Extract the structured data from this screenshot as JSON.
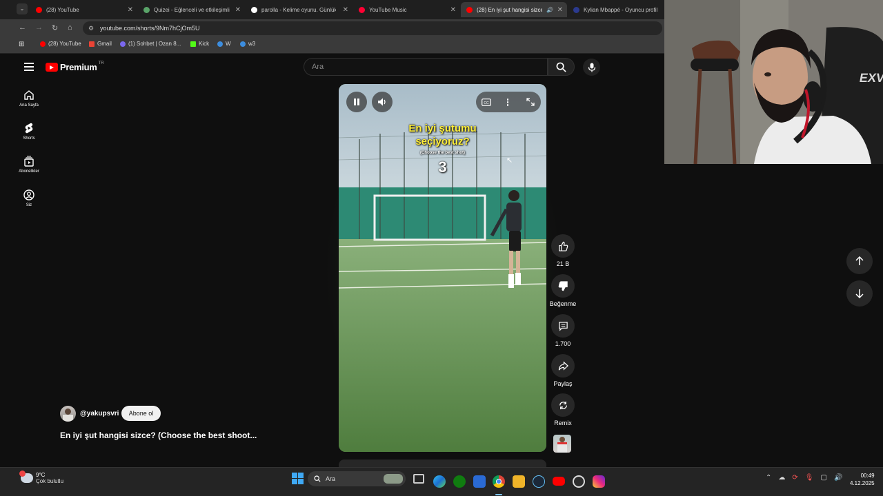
{
  "browser": {
    "tabs": [
      {
        "label": "(28) YouTube",
        "color": "#ff0000"
      },
      {
        "label": "Quizei - Eğlenceli ve etkileşimli",
        "color": "#5aa469"
      },
      {
        "label": "parolla - Kelime oyunu. Günlük",
        "color": "#ffffff"
      },
      {
        "label": "YouTube Music",
        "color": "#ff0033"
      },
      {
        "label": "(28) En iyi şut hangisi sizce",
        "color": "#ff0000"
      },
      {
        "label": "Kylian Mbappé - Oyuncu profil",
        "color": "#2b3a8f"
      }
    ],
    "url": "youtube.com/shorts/9Nm7hCjOm5U",
    "bookmarks": [
      {
        "label": "(28) YouTube",
        "color": "#ff0000"
      },
      {
        "label": "Gmail",
        "color": "#ea4335"
      },
      {
        "label": "(1) Sohbet | Ozan 8...",
        "color": "#7b68ee"
      },
      {
        "label": "Kick",
        "color": "#53fc18"
      },
      {
        "label": "W",
        "color": "#3c8dde"
      },
      {
        "label": "w3",
        "color": "#3c8dde"
      }
    ]
  },
  "youtube": {
    "logo": "Premium",
    "logo_badge": "TR",
    "search_placeholder": "Ara",
    "sidebar": [
      {
        "label": "Ana Sayfa",
        "icon": "home-icon"
      },
      {
        "label": "Shorts",
        "icon": "shorts-icon"
      },
      {
        "label": "Abonelikler",
        "icon": "subscriptions-icon"
      },
      {
        "label": "Siz",
        "icon": "user-icon"
      }
    ],
    "video": {
      "caption_line1": "En iyi şutumu",
      "caption_line2": "seçiyoruz?",
      "caption_sub": "(Choose the best shot)",
      "counter": "3"
    },
    "actions": {
      "likes": "21 B",
      "dislike": "Beğenme",
      "comments": "1.700",
      "share": "Paylaş",
      "remix": "Remix"
    },
    "channel": {
      "handle": "@yakupsvri",
      "subscribe": "Abone ol",
      "title": "En iyi şut hangisi sizce? (Choose the best shoot..."
    }
  },
  "taskbar": {
    "weather_temp": "9°C",
    "weather_desc": "Çok bulutlu",
    "search": "Ara",
    "time": "00:49",
    "date": "4.12.2025"
  },
  "webcam": {
    "chair_brand": "EXVE"
  }
}
